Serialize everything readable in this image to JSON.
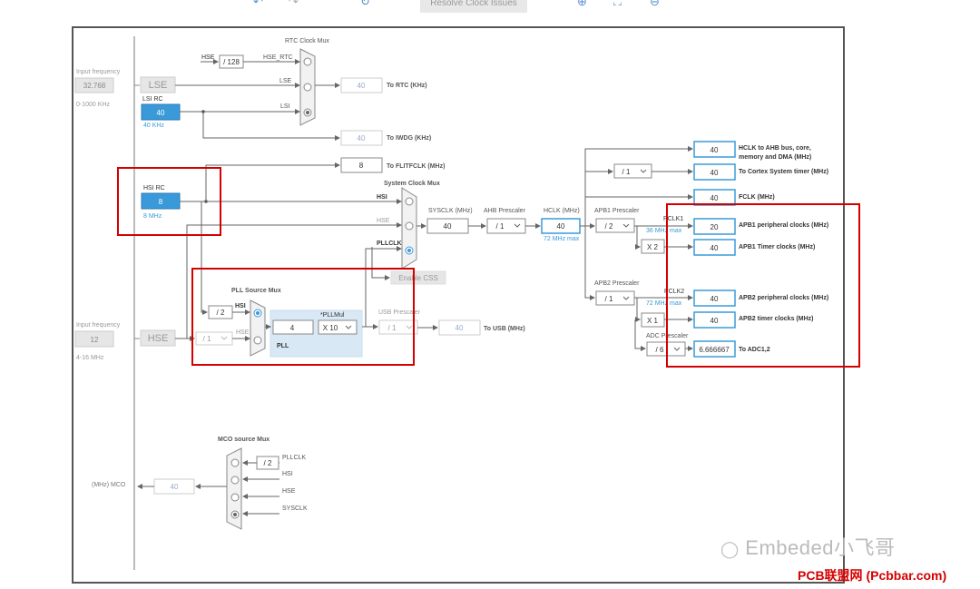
{
  "toolbar": {
    "resolve_label": "Resolve Clock Issues",
    "undo_icon": "undo-icon",
    "redo_icon": "redo-icon",
    "refresh_icon": "refresh-icon",
    "zoom_in_icon": "zoom-in-icon",
    "fit_icon": "fit-icon",
    "zoom_out_icon": "zoom-out-icon"
  },
  "left": {
    "input_freq_label": "Input frequency",
    "lse_freq": "32.768",
    "lse_range": "0-1000 KHz",
    "lse_label": "LSE",
    "lsi_rc_label": "LSI RC",
    "lsi_value": "40",
    "lsi_unit": "40 KHz",
    "hsi_rc_label": "HSI RC",
    "hsi_value": "8",
    "hsi_unit": "8 MHz",
    "hse_input_label": "Input frequency",
    "hse_freq": "12",
    "hse_range": "4-16 MHz",
    "hse_label": "HSE",
    "mco_label": "(MHz) MCO",
    "mco_value": "40"
  },
  "rtc": {
    "title": "RTC Clock Mux",
    "hse_label": "HSE",
    "div128": "/ 128",
    "hse_rtc": "HSE_RTC",
    "lse": "LSE",
    "lsi": "LSI",
    "rtc_value": "40",
    "rtc_out": "To RTC (KHz)",
    "iwdg_value": "40",
    "iwdg_out": "To IWDG (KHz)",
    "flitf_value": "8",
    "flitf_out": "To FLITFCLK (MHz)"
  },
  "sysmux": {
    "title": "System Clock Mux",
    "hsi": "HSI",
    "hse": "HSE",
    "pllclk": "PLLCLK",
    "enable_css": "Enable CSS"
  },
  "sysclk": {
    "label": "SYSCLK (MHz)",
    "value": "40",
    "ahb_label": "AHB Prescaler",
    "ahb_value": "/ 1",
    "hclk_label": "HCLK (MHz)",
    "hclk_value": "40",
    "hclk_max": "72 MHz max"
  },
  "pll": {
    "src_title": "PLL Source Mux",
    "div2": "/ 2",
    "hsi": "HSI",
    "hse": "HSE",
    "hse_div": "/ 1",
    "pll_in": "4",
    "pllmul_label": "*PLLMul",
    "pllmul_value": "X 10",
    "pll_label": "PLL",
    "usb_label": "USB Prescaler",
    "usb_div": "/ 1",
    "usb_value": "40",
    "usb_out": "To USB (MHz)"
  },
  "right": {
    "ahb_value": "40",
    "ahb_out_1": "HCLK to AHB bus, core,",
    "ahb_out_2": "memory and DMA (MHz)",
    "cortex_div": "/ 1",
    "cortex_value": "40",
    "cortex_out": "To Cortex System timer (MHz)",
    "fclk_value": "40",
    "fclk_out": "FCLK (MHz)",
    "apb1_label": "APB1 Prescaler",
    "apb1_div": "/ 2",
    "pclk1": "PCLK1",
    "apb1_max": "36 MHz max",
    "apb1_per_value": "20",
    "apb1_per_out": "APB1 peripheral clocks (MHz)",
    "apb1_x2": "X 2",
    "apb1_tim_value": "40",
    "apb1_tim_out": "APB1 Timer clocks (MHz)",
    "apb2_label": "APB2 Prescaler",
    "apb2_div": "/ 1",
    "pclk2": "PCLK2",
    "apb2_max": "72 MHz max",
    "apb2_per_value": "40",
    "apb2_per_out": "APB2 peripheral clocks (MHz)",
    "apb2_x1": "X 1",
    "apb2_tim_value": "40",
    "apb2_tim_out": "APB2 timer clocks (MHz)",
    "adc_label": "ADC Prescaler",
    "adc_div": "/ 6",
    "adc_value": "6.666667",
    "adc_out": "To ADC1,2"
  },
  "mco": {
    "title": "MCO source Mux",
    "div2": "/ 2",
    "pllclk": "PLLCLK",
    "hsi": "HSI",
    "hse": "HSE",
    "sysclk": "SYSCLK"
  },
  "watermark": {
    "brand": "Embeded小飞哥",
    "site": "PCB联盟网 (Pcbbar.com)"
  },
  "colors": {
    "blue": "#3a9ad9",
    "box_border": "#3a9ad9",
    "red": "#d40000",
    "line": "#666666"
  }
}
